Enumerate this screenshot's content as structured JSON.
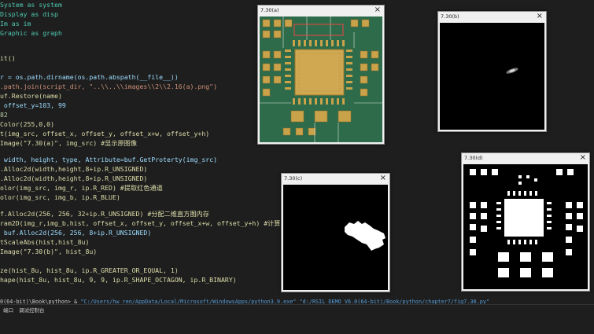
{
  "code_lines": [
    "System as system",
    "Display as disp",
    "Im as im",
    "Graphic as graph",
    "",
    "it()",
    "",
    "r = os.path.dirname(os.path.abspath(__file__))",
    ".path.join(script_dir, \"..\\\\..\\\\images\\\\2\\\\2.16(a).png\")",
    "uf.Restore(name)",
    " offset_y=103, 99",
    "82",
    "Color(255,0,0)",
    "t(img_src, offset_x, offset_y, offset_x+w, offset_y+h)",
    "Image(\"7.30(a)\", img_src) #显示原图像",
    "",
    " width, height, type, Attribute=buf.GetProterty(img_src)",
    ".Alloc2d(width,height,8+ip.R_UNSIGNED)",
    ".Alloc2d(width,height,8+ip.R_UNSIGNED)",
    "olor(img_src, img_r, ip.R_RED) #提取红色通道",
    "olor(img_src, img_b, ip.R_BLUE)",
    "",
    "f.Alloc2d(256, 256, 32+ip.R_UNSIGNED) #分配二维直方图内存",
    "ram2D(img_r,img_b,hist, offset_x, offset_y, offset_x+w, offset_y+h) #计算二维直方图",
    " buf.Alloc2d(256, 256, 8+ip.R_UNSIGNED)",
    "tScaleAbs(hist,hist_8u)",
    "Image(\"7.30(b)\", hist_8u)",
    "",
    "ze(hist_8u, hist_8u, ip.R_GREATER_OR_EQUAL, 1)",
    "hape(hist_8u, hist_8u, 9, 9, ip.R_SHAPE_OCTAGON, ip.R_BINARY)"
  ],
  "terminal": {
    "prefix": "0(64-bit)\\Book\\python> & ",
    "command": "\"C:/Users/hw ren/AppData/Local/Microsoft/WindowsApps/python3.9.exe\" \"d:/RSIL_DEMO_V6.0(64-bit)/Book/python/chapter7/fig7.30.py\""
  },
  "panel_tabs": [
    "端口",
    "调试控制台"
  ],
  "windows": [
    {
      "title": "7.30(a)",
      "close": "×"
    },
    {
      "title": "7.30(b)",
      "close": "×"
    },
    {
      "title": "7.30(c)",
      "close": "×"
    },
    {
      "title": "7.30(d)",
      "close": "×"
    }
  ],
  "colors": {
    "editor_bg": "#1e1e1e",
    "pcb_green": "#2c6e4c",
    "pad_gold": "#c9a24a"
  }
}
